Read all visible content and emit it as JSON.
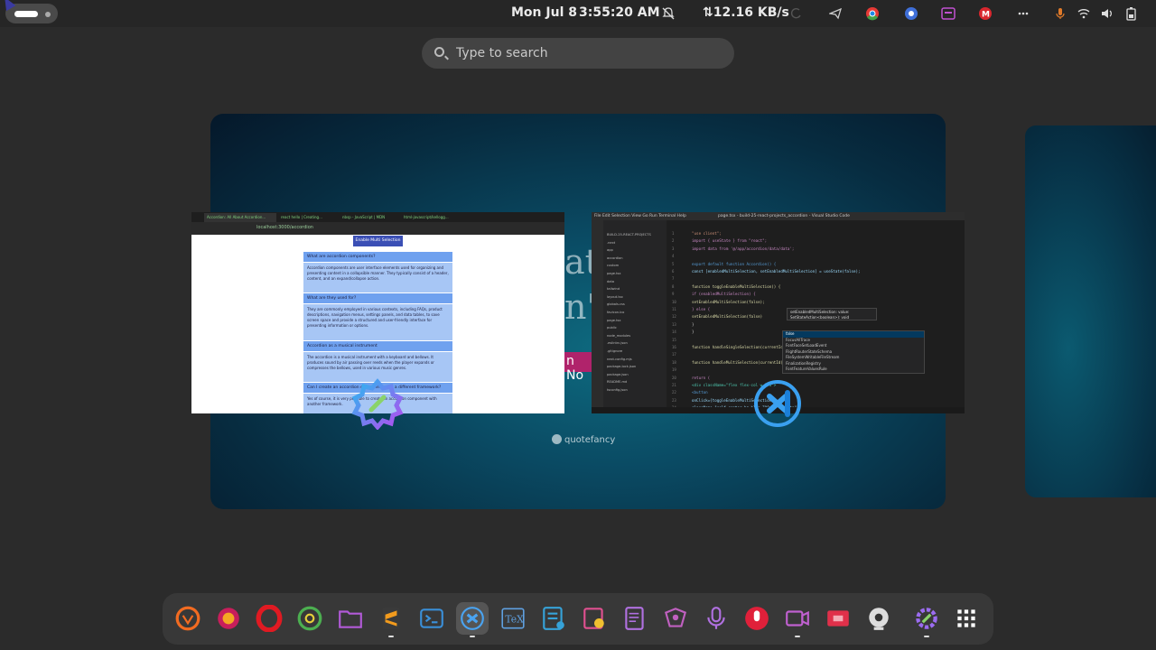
{
  "topbar": {
    "date": "Mon Jul 8",
    "time": "3:55:20 AM",
    "net_speed": "⇅12.16 KB/s",
    "tray_icons": [
      "sync-icon",
      "telegram-icon",
      "chrome-icon",
      "vpn-icon",
      "screenshot-icon",
      "mega-icon",
      "more-icon",
      "mic-muted-icon",
      "wifi-icon",
      "volume-icon",
      "battery-icon"
    ]
  },
  "search": {
    "placeholder": "Type to search"
  },
  "workspace": {
    "quote_fragments": [
      "at",
      "n't",
      "n No"
    ],
    "quote_logo": "quotefancy"
  },
  "browser_window": {
    "tabs": [
      "Accordion: All About Accordion...",
      "react hello | Creating...",
      "nbsp - JavaScript | MDN",
      "html-javascript/kellogg..."
    ],
    "url": "localhost:3000/accordion",
    "enable_button": "Enable Multi Selection",
    "accordion": [
      {
        "title": "What are accordion components?",
        "body": "Accordion components are user interface elements used for organizing and presenting content in a collapsible manner. They typically consist of a header, content, and an expand/collapse action."
      },
      {
        "title": "What are they used for?",
        "body": "They are commonly employed in various contexts, including FAQs, product descriptions, navigation menus, settings panels, and data tables, to save screen space and provide a structured and user-friendly interface for presenting information or options."
      },
      {
        "title": "Accordion as a musical instrument",
        "body": "The accordion is a musical instrument with a keyboard and bellows. It produces sound by air passing over reeds when the player expands or compresses the bellows, used in various music genres."
      },
      {
        "title": "Can I create an accordion component with a different framework?",
        "body": "Yes of course, it is very possible to create an accordion component with another framework."
      }
    ]
  },
  "vscode_window": {
    "title": "page.tsx - build-25-react-projects_accordion - Visual Studio Code",
    "menu": "File  Edit  Selection  View  Go  Run  Terminal  Help",
    "tree": [
      "BUILD-25-REACT-PROJECTS",
      ".next",
      "app",
      "accordion",
      "custom",
      "page.tsx",
      "data",
      "tailwind",
      "layout.tsx",
      "globals.css",
      "favicon.ico",
      "page.tsx",
      "public",
      "node_modules",
      ".eslintrc.json",
      ".gitignore",
      "next.config.mjs",
      "package-lock.json",
      "package.json",
      "README.md",
      "tsconfig.json"
    ],
    "code_lines": [
      {
        "n": "1",
        "text": "\"use client\";",
        "color": "#ce9178"
      },
      {
        "n": "2",
        "text": "import { useState } from \"react\";",
        "color": "#c586c0"
      },
      {
        "n": "3",
        "text": "import data from '@/app/accordion/data/data';",
        "color": "#c586c0"
      },
      {
        "n": "4",
        "text": "",
        "color": "#d4d4d4"
      },
      {
        "n": "5",
        "text": "export default function Accordion() {",
        "color": "#569cd6"
      },
      {
        "n": "6",
        "text": "  const [enabledMultiSelection, setEnabledMultiSelection] = useState(false);",
        "color": "#9cdcfe"
      },
      {
        "n": "7",
        "text": "",
        "color": "#d4d4d4"
      },
      {
        "n": "8",
        "text": "  function toggleEnableMultiSelection() {",
        "color": "#dcdcaa"
      },
      {
        "n": "9",
        "text": "    if (enabledMultiSelection) {",
        "color": "#c586c0"
      },
      {
        "n": "10",
        "text": "      setEnabledMultiSelection(false);",
        "color": "#dcdcaa"
      },
      {
        "n": "11",
        "text": "    } else {",
        "color": "#c586c0"
      },
      {
        "n": "12",
        "text": "      setEnabledMultiSelection(false)",
        "color": "#dcdcaa"
      },
      {
        "n": "13",
        "text": "    }",
        "color": "#d4d4d4"
      },
      {
        "n": "14",
        "text": "  }",
        "color": "#d4d4d4"
      },
      {
        "n": "15",
        "text": "",
        "color": "#d4d4d4"
      },
      {
        "n": "16",
        "text": "  function handleSingleSelection(currentId) {",
        "color": "#dcdcaa"
      },
      {
        "n": "17",
        "text": "",
        "color": "#d4d4d4"
      },
      {
        "n": "18",
        "text": "  function handleMultiSelection(currentId) {",
        "color": "#dcdcaa"
      },
      {
        "n": "19",
        "text": "",
        "color": "#d4d4d4"
      },
      {
        "n": "20",
        "text": "  return (",
        "color": "#c586c0"
      },
      {
        "n": "21",
        "text": "    <div className=\"flex flex-col w-1/3\">",
        "color": "#4ec9b0"
      },
      {
        "n": "22",
        "text": "      <button",
        "color": "#569cd6"
      },
      {
        "n": "23",
        "text": "        onClick={toggleEnableMultiSelection}",
        "color": "#9cdcfe"
      },
      {
        "n": "24",
        "text": "        className=\"self-center bg-blue-700 text-white\"",
        "color": "#9cdcfe"
      }
    ],
    "hint": [
      "setEnabledMultiSelection: value:",
      "SetStateAction<boolean>): void"
    ],
    "suggestions": [
      "false",
      "FocusAllTrace",
      "FontFaceSetLoadEvent",
      "FlightRouterStateSchema",
      "FileSystemWritableFileStream",
      "FinalizationRegistry",
      "FontFeatureValuesRule"
    ]
  },
  "dock": {
    "apps": [
      {
        "name": "brave-icon",
        "color": "#f26b21",
        "running": false
      },
      {
        "name": "firefox-icon",
        "color": "#c81e5b",
        "running": false
      },
      {
        "name": "opera-icon",
        "color": "#e01a22",
        "running": false
      },
      {
        "name": "chrome-icon",
        "color": "#4caf50",
        "running": false
      },
      {
        "name": "files-icon",
        "color": "#b25ad8",
        "running": false
      },
      {
        "name": "sublime-icon",
        "color": "#f29b1d",
        "running": true
      },
      {
        "name": "terminal-icon",
        "color": "#3a8fd8",
        "running": false
      },
      {
        "name": "vscode-icon",
        "color": "#4aa3f0",
        "running": true
      },
      {
        "name": "tex-icon",
        "color": "#5fa0e0",
        "running": false
      },
      {
        "name": "text-editor-icon",
        "color": "#36a2d8",
        "running": false
      },
      {
        "name": "notes-icon",
        "color": "#e05090",
        "running": false
      },
      {
        "name": "document-icon",
        "color": "#b070e0",
        "running": false
      },
      {
        "name": "inkscape-icon",
        "color": "#c060c0",
        "running": false
      },
      {
        "name": "microphone-icon",
        "color": "#b070e0",
        "running": false
      },
      {
        "name": "recorder-icon",
        "color": "#e0203a",
        "running": false
      },
      {
        "name": "video-icon",
        "color": "#c060d0",
        "running": true
      },
      {
        "name": "screen-cast-icon",
        "color": "#e0304a",
        "running": false
      },
      {
        "name": "webcam-icon",
        "color": "#dddddd",
        "running": false
      },
      {
        "name": "settings-icon",
        "color": "#9b6cf0",
        "running": true
      },
      {
        "name": "app-grid-icon",
        "color": "#ffffff",
        "running": false
      }
    ]
  }
}
